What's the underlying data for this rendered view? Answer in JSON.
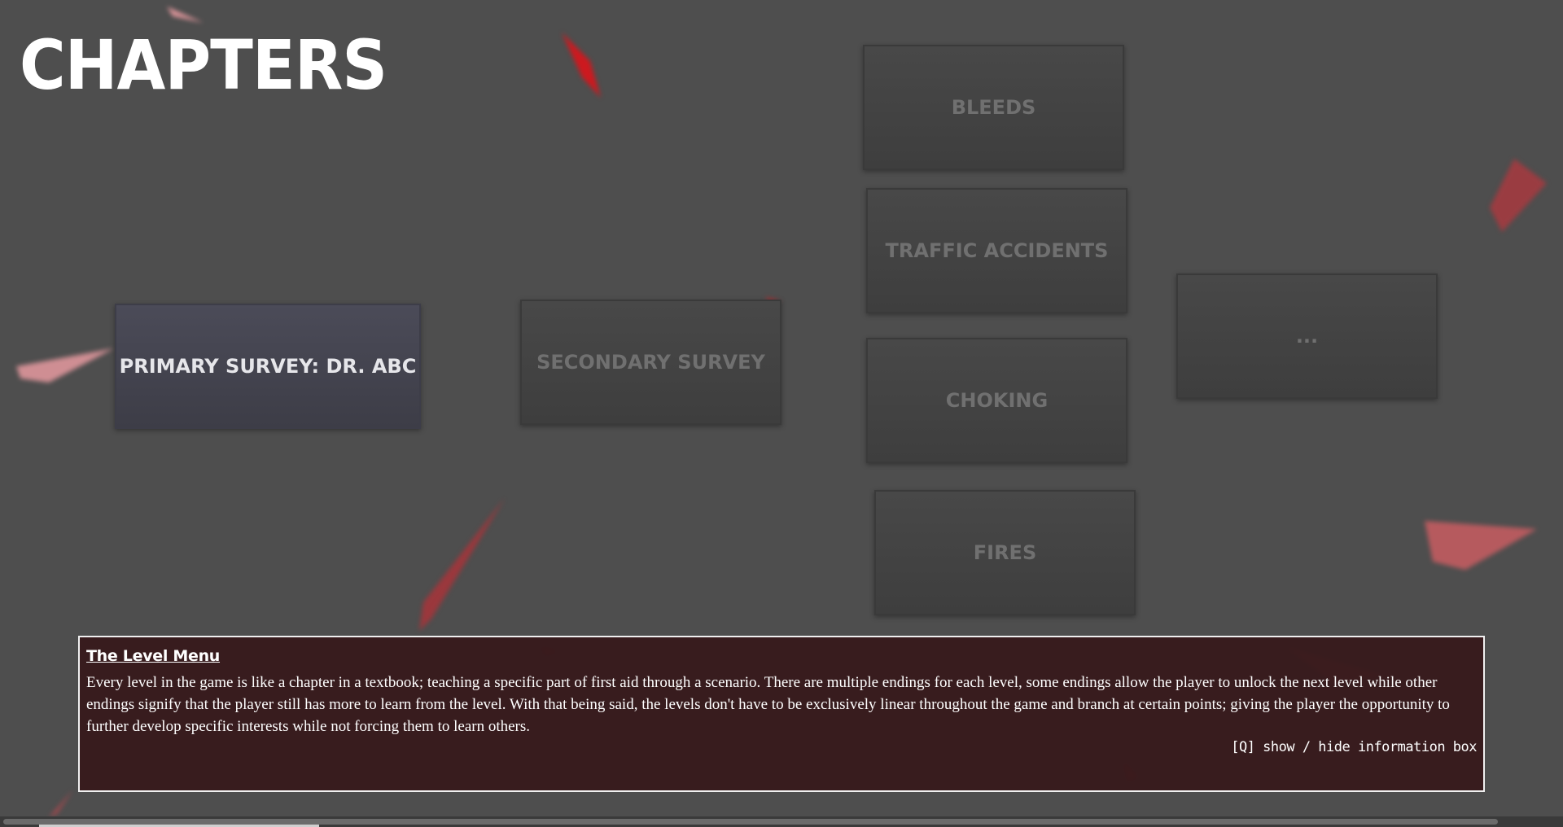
{
  "title": "CHAPTERS",
  "levels": [
    {
      "label": "PRIMARY SURVEY: DR. ABC",
      "unlocked": true
    },
    {
      "label": "SECONDARY SURVEY",
      "unlocked": false
    },
    {
      "label": "BLEEDS",
      "unlocked": false
    },
    {
      "label": "TRAFFIC ACCIDENTS",
      "unlocked": false
    },
    {
      "label": "CHOKING",
      "unlocked": false
    },
    {
      "label": "FIRES",
      "unlocked": false
    },
    {
      "label": "...",
      "unlocked": false
    }
  ],
  "info_box": {
    "heading": "The Level Menu",
    "body": "Every level in the game is like a chapter in a textbook; teaching a specific part of first aid through a scenario. There are multiple endings for each level, some endings allow the player to unlock the next level while other endings signify that the player still has more to learn from the level. With that being said, the levels don't have to be exclusively linear throughout the game and branch at certain points; giving the player the opportunity to further develop specific interests while not forcing them to learn others.",
    "hint": "[Q] show / hide information box"
  },
  "colors": {
    "background": "#4e4e4e",
    "unlocked_button": "#44444f",
    "locked_button": "#434343",
    "info_box_bg": "#371a1c",
    "accent_red": "#c0262c"
  }
}
